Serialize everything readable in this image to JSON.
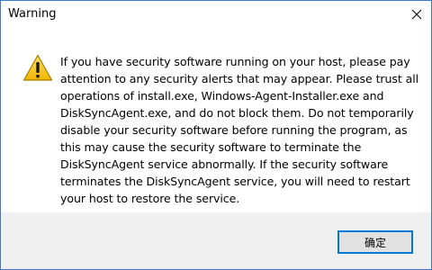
{
  "dialog": {
    "title": "Warning",
    "message": "If you have security software running on your host, please pay attention to any security alerts that may appear. Please trust all operations of install.exe, Windows-Agent-Installer.exe and DiskSyncAgent.exe, and do not block them. Do not temporarily disable your security software before running the program, as this may cause the security software to terminate the DiskSyncAgent service abnormally. If the security software terminates the DiskSyncAgent service, you will need to restart your host to restore the service.",
    "ok_label": "确定",
    "icon": "warning-triangle-icon",
    "close_icon": "close-icon"
  },
  "colors": {
    "border": "#3c78c8",
    "footer_bg": "#f0f0f0",
    "button_border": "#0078d7",
    "button_bg": "#e1e1e1",
    "warning_yellow": "#f2c200"
  }
}
